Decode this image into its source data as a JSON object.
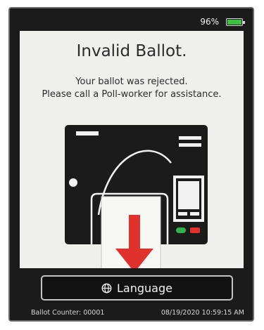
{
  "status": {
    "battery_level": "96%",
    "battery_fraction": 0.96
  },
  "screen": {
    "title": "Invalid Ballot.",
    "message_line1": "Your ballot was rejected.",
    "message_line2": "Please call a Poll-worker for assistance."
  },
  "illustration": {
    "icon": "ballot-rejected-scanner-icon",
    "arrow_color": "#e0322c",
    "indicator_colors": {
      "green": "#2fb34a",
      "red": "#e0322c"
    }
  },
  "footer": {
    "language_label": "Language",
    "language_icon": "globe-icon",
    "ballot_counter": "Ballot Counter: 00001",
    "datetime": "08/19/2020 10:59:15 AM"
  }
}
